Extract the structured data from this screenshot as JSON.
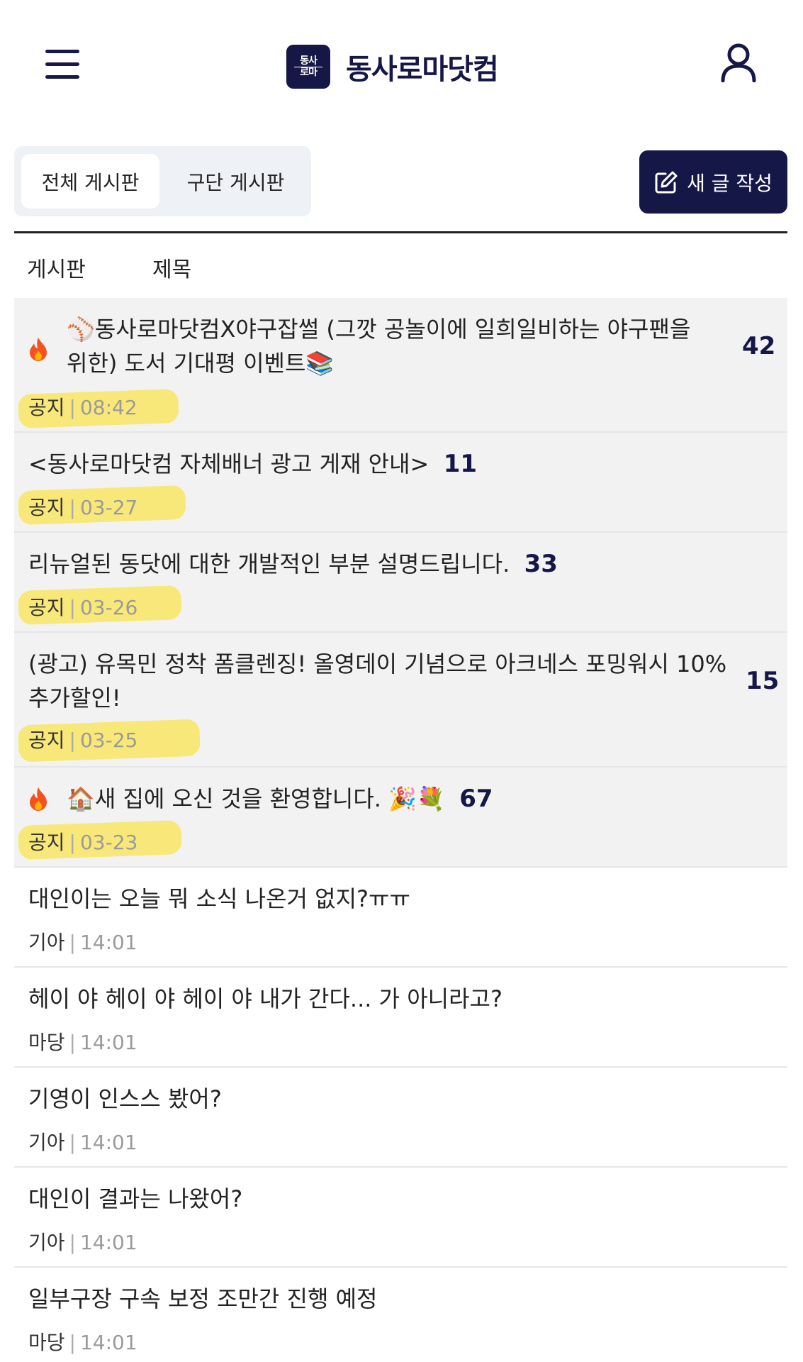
{
  "header": {
    "logo_mark": [
      "동사",
      "로마"
    ],
    "site_name": "동사로마닷컴"
  },
  "tabs": {
    "all": "전체 게시판",
    "team": "구단 게시판"
  },
  "write_button": "새 글 작성",
  "columns": {
    "board": "게시판",
    "title": "제목"
  },
  "posts": [
    {
      "title_line1": "⚾동사로마닷컴X야구잡썰 (그깟 공놀이에 일희일비하는 야구팬을",
      "title_line2": "위한) 도서 기대평 이벤트📚",
      "count": "42",
      "board": "공지",
      "time": "08:42",
      "hot": true
    },
    {
      "title": "<동사로마닷컴 자체배너 광고 게재 안내>",
      "count": "11",
      "board": "공지",
      "time": "03-27",
      "hot": false
    },
    {
      "title": "리뉴얼된 동닷에 대한 개발적인 부분 설명드립니다.",
      "count": "33",
      "board": "공지",
      "time": "03-26",
      "hot": false
    },
    {
      "title_line1": "(광고) 유목민 정착 폼클렌징! 올영데이 기념으로 아크네스 포밍워시 10%",
      "title_line2": "추가할인!",
      "count": "15",
      "board": "공지",
      "time": "03-25",
      "hot": false
    },
    {
      "title": "🏠새 집에 오신 것을 환영합니다. 🎉💐",
      "count": "67",
      "board": "공지",
      "time": "03-23",
      "hot": true
    },
    {
      "title": "대인이는 오늘 뭐 소식 나온거 없지?ㅠㅠ",
      "board": "기아",
      "time": "14:01"
    },
    {
      "title": "헤이 야 헤이 야 헤이 야 내가 간다... 가 아니라고?",
      "board": "마당",
      "time": "14:01"
    },
    {
      "title": "기영이 인스스 봤어?",
      "board": "기아",
      "time": "14:01"
    },
    {
      "title": "대인이 결과는 나왔어?",
      "board": "기아",
      "time": "14:01"
    },
    {
      "title": "일부구장 구속 보정 조만간 진행 예정",
      "board": "마당",
      "time": "14:01"
    }
  ],
  "colors": {
    "navy": "#151847",
    "highlight": "#f9e34a",
    "notice_bg": "#f2f2f2"
  }
}
